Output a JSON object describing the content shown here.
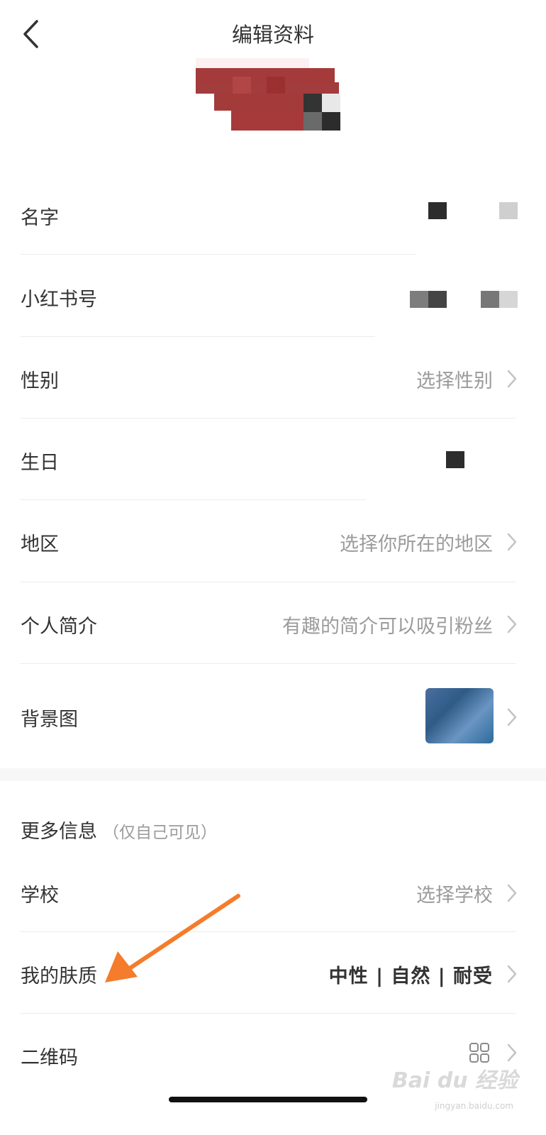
{
  "header": {
    "title": "编辑资料",
    "back_icon": "chevron-left-icon"
  },
  "rows": {
    "name": {
      "label": "名字"
    },
    "redbook_id": {
      "label": "小红书号"
    },
    "gender": {
      "label": "性别",
      "value": "选择性别"
    },
    "birthday": {
      "label": "生日"
    },
    "region": {
      "label": "地区",
      "value": "选择你所在的地区"
    },
    "bio": {
      "label": "个人简介",
      "value": "有趣的简介可以吸引粉丝"
    },
    "background": {
      "label": "背景图"
    }
  },
  "more_info": {
    "title": "更多信息",
    "subtitle": "（仅自己可见）",
    "school": {
      "label": "学校",
      "value": "选择学校"
    },
    "skin_type": {
      "label": "我的肤质",
      "value": "中性 | 自然 | 耐受"
    },
    "qrcode": {
      "label": "二维码",
      "icon": "qr-grid-icon"
    }
  },
  "colors": {
    "accent_arrow": "#f47c2a",
    "secondary_text": "#9b9b9b",
    "primary_text": "#333333"
  },
  "watermark": {
    "text": "Bai du 经验",
    "sub": "jingyan.baidu.com"
  }
}
